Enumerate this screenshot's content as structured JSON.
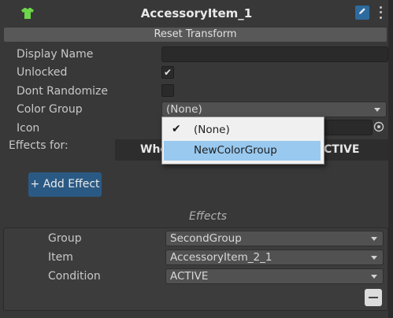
{
  "header": {
    "title": "AccessoryItem_1",
    "icon": "tshirt-icon",
    "accent": "#6ed64a"
  },
  "reset_label": "Reset Transform",
  "properties": {
    "display_name": {
      "label": "Display Name",
      "value": ""
    },
    "unlocked": {
      "label": "Unlocked",
      "checked": true,
      "mark": "✔"
    },
    "dont_randomize": {
      "label": "Dont Randomize",
      "checked": false
    },
    "color_group": {
      "label": "Color Group",
      "value": "(None)"
    },
    "icon": {
      "label": "Icon"
    },
    "effects_for": {
      "label": "Effects for:",
      "left_text": "Whe",
      "right_text": "CTIVE"
    }
  },
  "add_effect_label": "+ Add Effect",
  "effects": {
    "title": "Effects",
    "group": {
      "label": "Group",
      "value": "SecondGroup"
    },
    "item": {
      "label": "Item",
      "value": "AccessoryItem_2_1"
    },
    "condition": {
      "label": "Condition",
      "value": "ACTIVE"
    }
  },
  "popup": {
    "options": [
      {
        "label": "(None)",
        "checked": true,
        "mark": "✔"
      },
      {
        "label": "NewColorGroup",
        "highlighted": true
      }
    ]
  }
}
